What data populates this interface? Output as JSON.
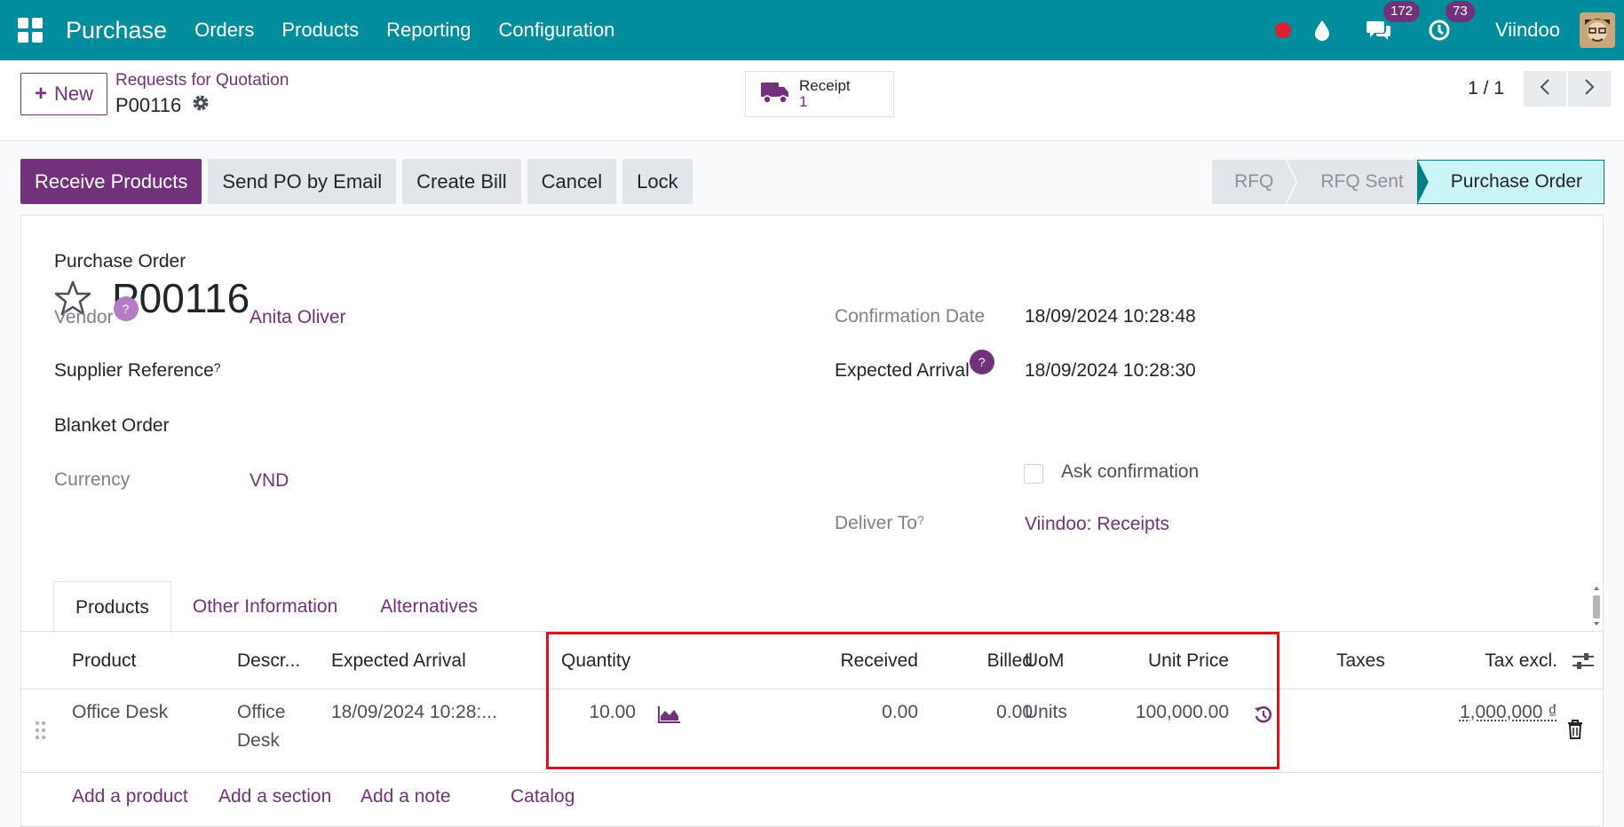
{
  "topbar": {
    "app_name": "Purchase",
    "menu": [
      "Orders",
      "Products",
      "Reporting",
      "Configuration"
    ],
    "messages_count": "172",
    "activities_count": "73",
    "user_name": "Viindoo",
    "colors": {
      "bar": "#018d9b",
      "badge": "#71317b",
      "record": "#dc1f35"
    }
  },
  "control": {
    "new_label": "New",
    "breadcrumb": "Requests for Quotation",
    "record_name": "P00116",
    "smart_button": {
      "label": "Receipt",
      "count": "1",
      "icon": "truck-icon"
    },
    "pager": "1 / 1"
  },
  "actions": [
    "Receive Products",
    "Send PO by Email",
    "Create Bill",
    "Cancel",
    "Lock"
  ],
  "statusbar": {
    "stages": [
      "RFQ",
      "RFQ Sent",
      "Purchase Order"
    ],
    "active": "Purchase Order"
  },
  "form": {
    "doc_type": "Purchase Order",
    "title": "P00116",
    "vendor_label": "Vendor",
    "vendor": "Anita Oliver",
    "supplier_ref_label": "Supplier Reference",
    "blanket_label": "Blanket Order",
    "currency_label": "Currency",
    "currency": "VND",
    "confirmation_label": "Confirmation Date",
    "confirmation_date": "18/09/2024 10:28:48",
    "expected_label": "Expected Arrival",
    "expected_date": "18/09/2024 10:28:30",
    "ask_confirmation": "Ask confirmation",
    "deliver_label": "Deliver To",
    "deliver_to": "Viindoo: Receipts",
    "help_mark": "?"
  },
  "tabs": [
    "Products",
    "Other Information",
    "Alternatives"
  ],
  "table": {
    "headers": {
      "product": "Product",
      "description": "Descr...",
      "expected": "Expected Arrival",
      "quantity": "Quantity",
      "received": "Received",
      "billed": "Billed",
      "uom": "UoM",
      "unit_price": "Unit Price",
      "taxes": "Taxes",
      "tax_excl": "Tax excl."
    },
    "rows": [
      {
        "product": "Office Desk",
        "description_line1": "Office",
        "description_line2": "Desk",
        "expected": "18/09/2024 10:28:...",
        "quantity": "10.00",
        "received": "0.00",
        "billed": "0.00",
        "uom": "Units",
        "unit_price": "100,000.00",
        "tax_excl": "1,000,000 ₫"
      }
    ],
    "add_links": [
      "Add a product",
      "Add a section",
      "Add a note",
      "Catalog"
    ]
  }
}
